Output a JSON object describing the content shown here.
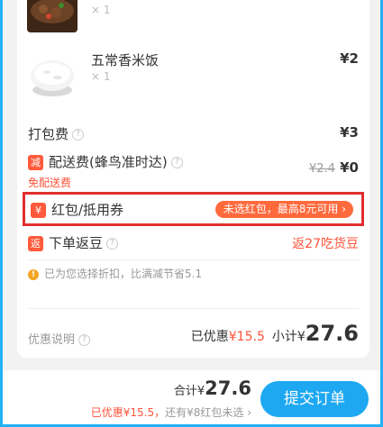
{
  "items": [
    {
      "name": "",
      "qty": "× 1",
      "price": ""
    },
    {
      "name": "五常香米饭",
      "qty": "× 1",
      "price": "¥2"
    }
  ],
  "fees": {
    "packing_label": "打包费",
    "packing_price": "¥3",
    "delivery_badge": "减",
    "delivery_label": "配送费(蜂鸟准时达)",
    "delivery_original": "¥2.4",
    "delivery_price": "¥0",
    "free_delivery_note": "免配送费"
  },
  "coupon": {
    "badge": "¥",
    "label": "红包/抵用券",
    "pill_text": "未选红包，最高8元可用",
    "pill_chevron": "›"
  },
  "cashback": {
    "badge": "返",
    "label": "下单返豆",
    "value": "返27吃货豆"
  },
  "notice": {
    "icon": "!",
    "text": "已为您选择折扣，比满减节省5.1"
  },
  "summary": {
    "discount_info_label": "优惠说明",
    "discount_prefix": "已优惠",
    "discount_value": "¥15.5",
    "subtotal_prefix": "小计¥",
    "subtotal_value": "27.6"
  },
  "footer": {
    "total_prefix": "合计¥",
    "total_value": "27.6",
    "savings": "已优惠¥15.5，",
    "unselected": "还有¥8红包未选",
    "chevron": "›",
    "submit_label": "提交订单"
  },
  "colors": {
    "accent_blue": "#1ea8f2",
    "accent_red": "#ff5339",
    "frame_blue": "#22b2f5",
    "highlight_border": "#e02f2f"
  }
}
